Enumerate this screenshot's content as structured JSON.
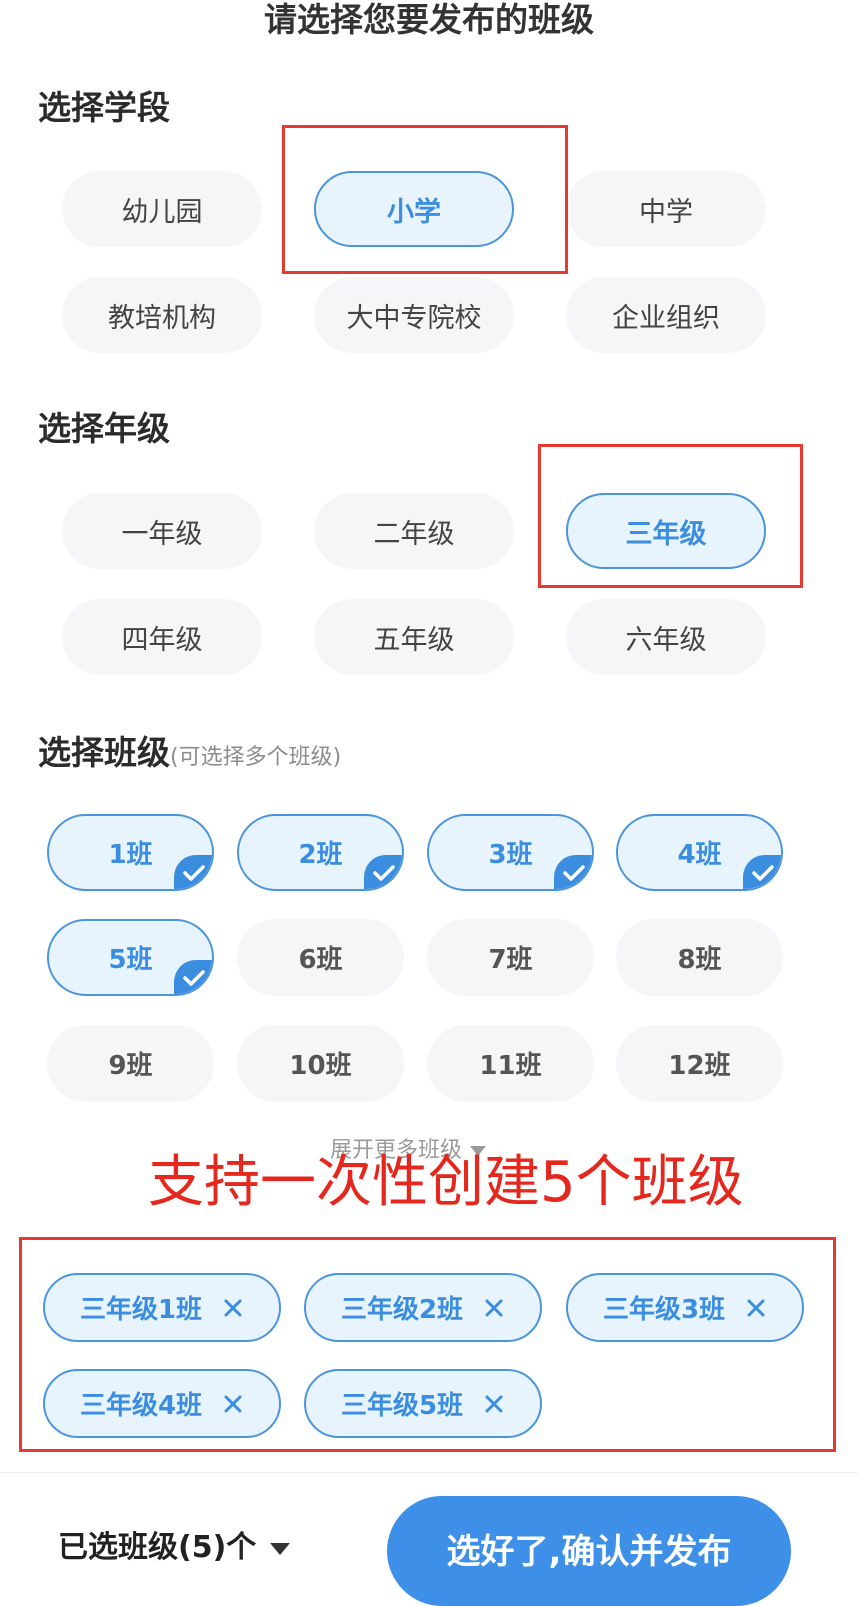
{
  "header": {
    "title": "请选择您要发布的班级"
  },
  "stage_section": {
    "heading": "选择学段",
    "options": [
      "幼儿园",
      "小学",
      "中学",
      "教培机构",
      "大中专院校",
      "企业组织"
    ],
    "selected": "小学"
  },
  "grade_section": {
    "heading": "选择年级",
    "options": [
      "一年级",
      "二年级",
      "三年级",
      "四年级",
      "五年级",
      "六年级"
    ],
    "selected": "三年级"
  },
  "class_section": {
    "heading": "选择班级",
    "hint": "(可选择多个班级)",
    "options": [
      "1班",
      "2班",
      "3班",
      "4班",
      "5班",
      "6班",
      "7班",
      "8班",
      "9班",
      "10班",
      "11班",
      "12班"
    ],
    "selected": [
      "1班",
      "2班",
      "3班",
      "4班",
      "5班"
    ],
    "expand_label": "展开更多班级"
  },
  "annotation": {
    "text": "支持一次性创建5个班级",
    "color": "#e5281e"
  },
  "selected_classes": [
    "三年级1班",
    "三年级2班",
    "三年级3班",
    "三年级4班",
    "三年级5班"
  ],
  "footer": {
    "summary_label": "已选班级(5)个",
    "confirm_label": "选好了,确认并发布"
  },
  "colors": {
    "accent": "#3b8de0",
    "selected_bg": "#e7f3fd",
    "chip_bg": "#f5f6f8",
    "annotation_red": "#e53a32"
  }
}
